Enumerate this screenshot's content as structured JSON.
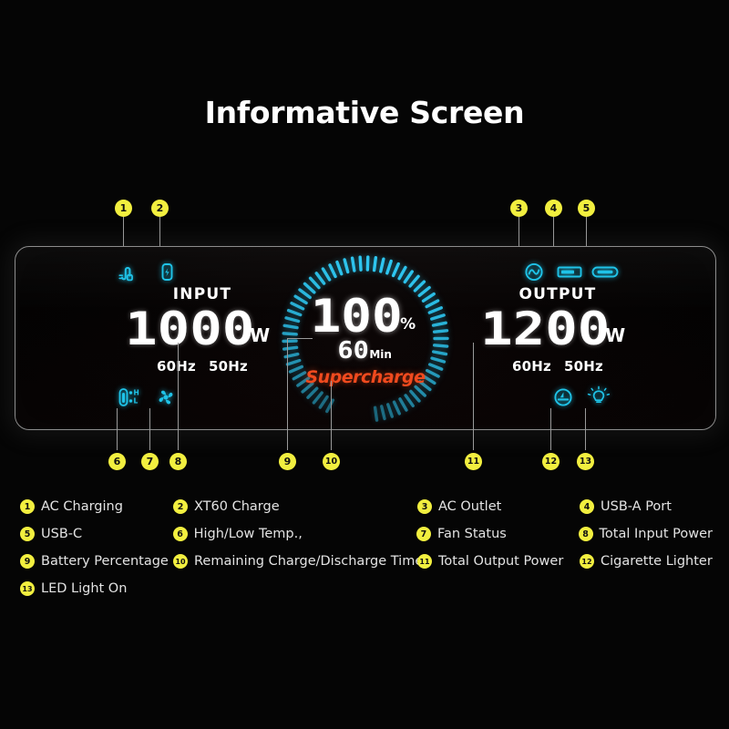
{
  "page": {
    "title": "Informative Screen",
    "background": "#050505",
    "accent_yellow": "#f2ef3f",
    "accent_cyan": "#1fc3e8",
    "accent_orange": "#f04a1e"
  },
  "display": {
    "input": {
      "label": "INPUT",
      "value": "1000",
      "unit": "W",
      "freq_a": "60Hz",
      "freq_b": "50Hz"
    },
    "output": {
      "label": "OUTPUT",
      "value": "1200",
      "unit": "W",
      "freq_a": "60Hz",
      "freq_b": "50Hz"
    },
    "gauge": {
      "percent": "100",
      "percent_symbol": "%",
      "time_value": "60",
      "time_unit": "Min",
      "status": "Supercharge",
      "ticks": 60,
      "fill_percent": 100
    },
    "icons_top_left": [
      {
        "name": "ac-charging-icon",
        "label": "AC Charging"
      },
      {
        "name": "xt60-charge-icon",
        "label": "XT60 Charge"
      }
    ],
    "icons_top_right": [
      {
        "name": "ac-outlet-icon",
        "label": "AC Outlet"
      },
      {
        "name": "usb-a-port-icon",
        "label": "USB-A Port"
      },
      {
        "name": "usb-c-port-icon",
        "label": "USB-C"
      }
    ],
    "icons_bottom_left": [
      {
        "name": "temperature-icon",
        "label": "High/Low Temp.",
        "marks": [
          "H",
          "L"
        ]
      },
      {
        "name": "fan-icon",
        "label": "Fan Status"
      }
    ],
    "icons_bottom_right": [
      {
        "name": "cigarette-lighter-icon",
        "label": "Cigarette Lighter"
      },
      {
        "name": "led-light-icon",
        "label": "LED Light On"
      }
    ]
  },
  "callouts": {
    "top": [
      "1",
      "2",
      "3",
      "4",
      "5"
    ],
    "bottom": [
      "6",
      "7",
      "8",
      "9",
      "10",
      "11",
      "12",
      "13"
    ]
  },
  "legend": {
    "rows": [
      [
        {
          "num": "1",
          "text": "AC Charging"
        },
        {
          "num": "2",
          "text": "XT60 Charge"
        },
        {
          "num": "3",
          "text": "AC Outlet"
        },
        {
          "num": "4",
          "text": "USB-A Port"
        }
      ],
      [
        {
          "num": "5",
          "text": "USB-C"
        },
        {
          "num": "6",
          "text": "High/Low Temp.,"
        },
        {
          "num": "7",
          "text": "Fan Status"
        },
        {
          "num": "8",
          "text": "Total Input Power"
        }
      ],
      [
        {
          "num": "9",
          "text": "Battery Percentage"
        },
        {
          "num": "10",
          "text": "Remaining Charge/Discharge Time"
        },
        {
          "num": "11",
          "text": "Total Output Power"
        },
        {
          "num": "12",
          "text": "Cigarette Lighter"
        }
      ],
      [
        {
          "num": "13",
          "text": "LED Light On"
        }
      ]
    ]
  }
}
